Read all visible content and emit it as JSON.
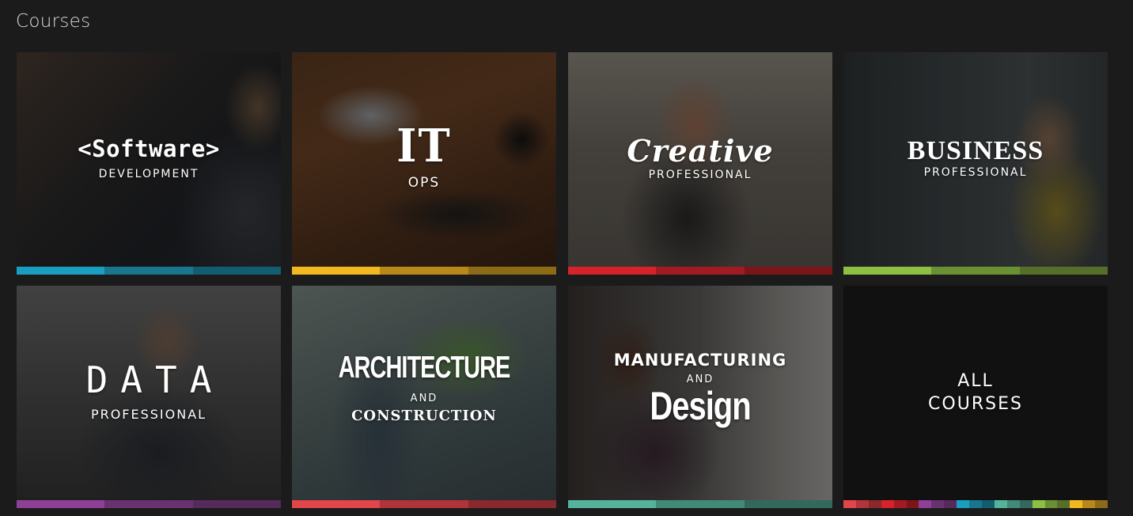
{
  "page": {
    "title": "Courses"
  },
  "tiles": [
    {
      "main": "<Software>",
      "sub": "DEVELOPMENT",
      "colors": [
        "#1a9ec0",
        "#18768e",
        "#135d71"
      ]
    },
    {
      "main": "IT",
      "sub": "OPS",
      "colors": [
        "#f2b81f",
        "#b8891a",
        "#8d6a15"
      ]
    },
    {
      "main": "Creative",
      "sub": "PROFESSIONAL",
      "colors": [
        "#d7222a",
        "#a21b22",
        "#7b151a"
      ]
    },
    {
      "main": "BUSINESS",
      "sub": "PROFESSIONAL",
      "colors": [
        "#8dc042",
        "#6a9034",
        "#556f2b"
      ]
    },
    {
      "main": "DATA",
      "sub": "PROFESSIONAL",
      "colors": [
        "#8e3f96",
        "#6a3170",
        "#562a5b"
      ]
    },
    {
      "main": "ARCHITECTURE",
      "and": "AND",
      "sub": "CONSTRUCTION",
      "colors": [
        "#e2454a",
        "#b03439",
        "#8a292d"
      ]
    },
    {
      "main": "MANUFACTURING",
      "and": "AND",
      "sub": "Design",
      "colors": [
        "#54b49b",
        "#418a78",
        "#33695d"
      ]
    },
    {
      "line1": "ALL",
      "line2": "COURSES",
      "colors": [
        "#e2454a",
        "#b03439",
        "#8a292d",
        "#d7222a",
        "#a21b22",
        "#7b151a",
        "#8e3f96",
        "#6a3170",
        "#562a5b",
        "#1a9ec0",
        "#18768e",
        "#135d71",
        "#54b49b",
        "#418a78",
        "#33695d",
        "#8dc042",
        "#6a9034",
        "#556f2b",
        "#f2b81f",
        "#b8891a",
        "#8d6a15"
      ]
    }
  ]
}
